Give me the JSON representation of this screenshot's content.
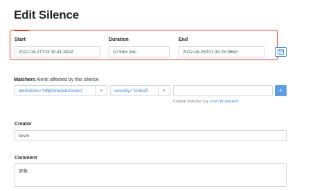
{
  "page": {
    "title": "Edit Silence"
  },
  "timing": {
    "start_label": "Start",
    "start_value": "2022-04-27T23:30:41.922Z",
    "duration_label": "Duration",
    "duration_value": "1h 59m 44s",
    "end_label": "End",
    "end_value": "2022-04-28T01:30:25.966Z",
    "calendar_icon": "calendar-icon"
  },
  "matchers": {
    "label": "Matchers",
    "description": "Alerts affected by this silence",
    "items": [
      {
        "value": "alertname=\"HttpSimulatorDown\"",
        "remove": "×"
      },
      {
        "value": "severity=\"critical\"",
        "remove": "×"
      }
    ],
    "new_value": "",
    "add_label": "+",
    "hint_prefix": "Custom matcher, e.g.",
    "hint_example": "env=\"production\""
  },
  "creator": {
    "label": "Creator",
    "value": "kevin"
  },
  "comment": {
    "label": "Comment",
    "value": "屏蔽"
  },
  "colors": {
    "highlight": "#e03b2e",
    "accent": "#2e86de",
    "remove": "#dc3545"
  }
}
